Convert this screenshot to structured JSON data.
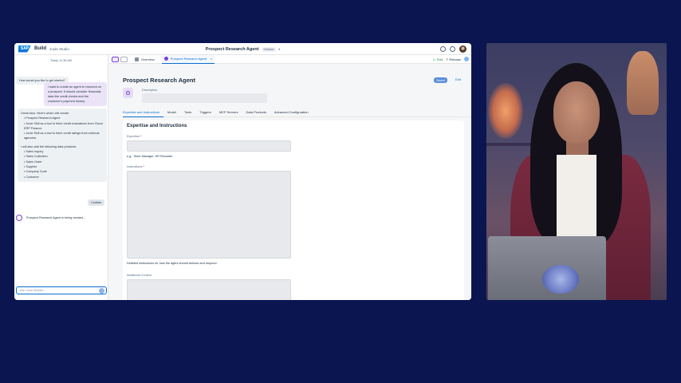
{
  "shell": {
    "logo": "SAP",
    "brand": "Build",
    "product": "Joule Studio",
    "title": "Prospect Research Agent",
    "badge": "Editable",
    "chevron": "▾"
  },
  "chat": {
    "date": "Today 11:35 AM",
    "prompt_chip": "How would you like to get started?",
    "user_message": "I want to create an agent to research on a prospect. It should consider financials data like credit checks and the customer's payment history.",
    "reply_intro": "Great idea. Here's what I will create:",
    "reply_items": [
      "Prospect Research Agent",
      "Joule Skill as a tool to fetch credit evaluations from Cloud ERP Finance.",
      "Joule Skill as a tool to fetch credit ratings from external agencies."
    ],
    "reply_outro": "I will also add the following data products:",
    "data_products": [
      "Sales Inquiry",
      "Sales Collection",
      "Sales Order",
      "Supplier",
      "Company Code",
      "Customer"
    ],
    "confirm_label": "Confirm",
    "status_text": "Prospect Research Agent is being created...",
    "input_placeholder": "Ask Joule Builder..."
  },
  "tabs": {
    "overview": "Overview",
    "agent": "Prospect Research Agent",
    "close": "×",
    "test": "▷ Test",
    "release": "⇪ Release"
  },
  "agent": {
    "title": "Prospect Research Agent",
    "saved": "Saved",
    "edit": "Edit",
    "description_label": "Description",
    "subtabs": [
      "Expertise and Instructions",
      "Model",
      "Tools",
      "Triggers",
      "MCP Servers",
      "Data Products",
      "Advanced Configuration"
    ],
    "section_title": "Expertise and Instructions",
    "expertise_label": "Expertise",
    "expertise_hint": "e.g., Store Manager, HR Recruiter",
    "instructions_label": "Instructions",
    "instructions_hint": "Detailed instructions for how the agent should behave and respond.",
    "context_label": "Additional Context",
    "required_mark": "*"
  },
  "colors": {
    "background": "#0b1650",
    "accent": "#0a6ed1",
    "joule_purple": "#7a3fd6"
  }
}
